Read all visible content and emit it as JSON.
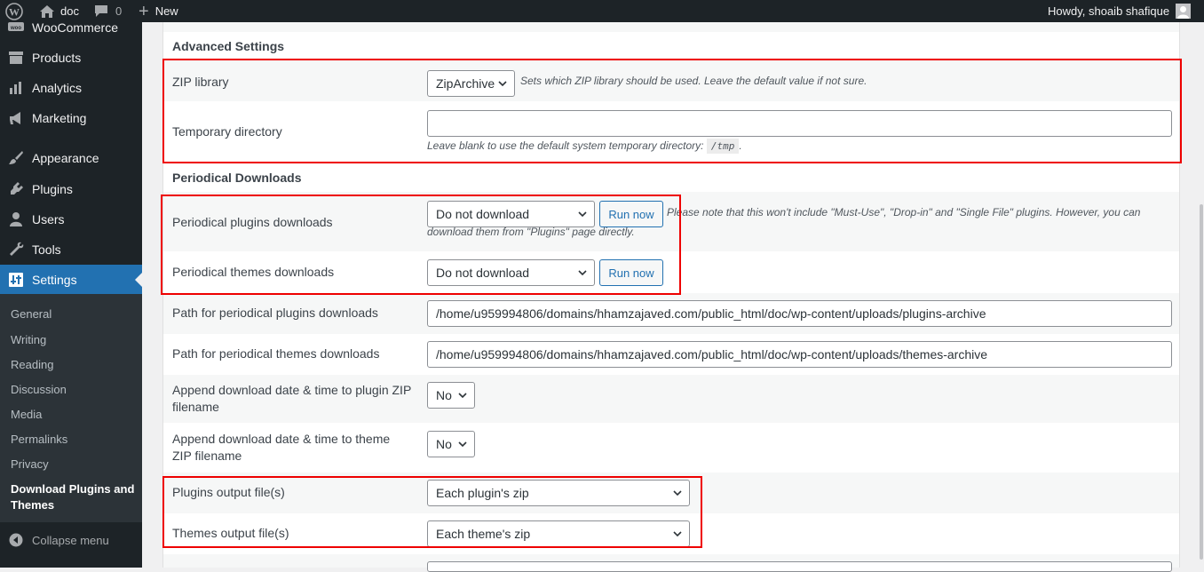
{
  "adminbar": {
    "site_name": "doc",
    "comments_count": "0",
    "new_label": "New",
    "howdy": "Howdy, shoaib shafique"
  },
  "sidebar": {
    "items": [
      {
        "label": "WooCommerce",
        "icon": "woo-icon"
      },
      {
        "label": "Products",
        "icon": "products-icon"
      },
      {
        "label": "Analytics",
        "icon": "analytics-icon"
      },
      {
        "label": "Marketing",
        "icon": "megaphone-icon"
      },
      {
        "label": "Appearance",
        "icon": "paintbrush-icon"
      },
      {
        "label": "Plugins",
        "icon": "plugin-icon"
      },
      {
        "label": "Users",
        "icon": "users-icon"
      },
      {
        "label": "Tools",
        "icon": "wrench-icon"
      },
      {
        "label": "Settings",
        "icon": "settings-icon"
      }
    ],
    "submenu": [
      "General",
      "Writing",
      "Reading",
      "Discussion",
      "Media",
      "Permalinks",
      "Privacy",
      "Download Plugins and Themes"
    ],
    "collapse_label": "Collapse menu"
  },
  "advanced": {
    "title": "Advanced Settings",
    "zip_label": "ZIP library",
    "zip_value": "ZipArchive",
    "zip_desc": "Sets which ZIP library should be used. Leave the default value if not sure.",
    "temp_label": "Temporary directory",
    "temp_value": "",
    "temp_desc_prefix": "Leave blank to use the default system temporary directory:",
    "temp_desc_code": "/tmp",
    "temp_desc_suffix": "."
  },
  "periodical": {
    "title": "Periodical Downloads",
    "plugins_label": "Periodical plugins downloads",
    "plugins_value": "Do not download",
    "run_now": "Run now",
    "plugins_note": "Please note that this won't include \"Must-Use\", \"Drop-in\" and \"Single File\" plugins. However, you can download them from \"Plugins\" page directly.",
    "themes_label": "Periodical themes downloads",
    "themes_value": "Do not download",
    "plugins_path_label": "Path for periodical plugins downloads",
    "plugins_path_value": "/home/u959994806/domains/hhamzajaved.com/public_html/doc/wp-content/uploads/plugins-archive",
    "themes_path_label": "Path for periodical themes downloads",
    "themes_path_value": "/home/u959994806/domains/hhamzajaved.com/public_html/doc/wp-content/uploads/themes-archive",
    "append_plugin_label": "Append download date & time to plugin ZIP filename",
    "append_plugin_value": "No",
    "append_theme_label": "Append download date & time to theme ZIP filename",
    "append_theme_value": "No",
    "plugins_output_label": "Plugins output file(s)",
    "plugins_output_value": "Each plugin's zip",
    "themes_output_label": "Themes output file(s)",
    "themes_output_value": "Each theme's zip"
  },
  "colors": {
    "accent": "#2271b1",
    "highlight_border": "#e00000",
    "sidebar_bg": "#1d2327"
  }
}
